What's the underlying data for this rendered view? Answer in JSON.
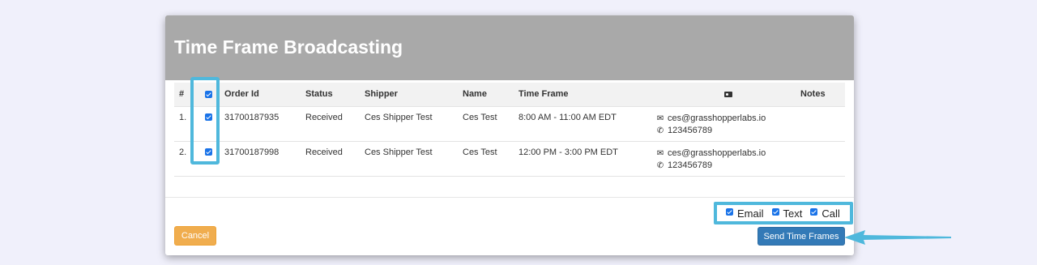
{
  "modal": {
    "title": "Time Frame Broadcasting"
  },
  "table": {
    "headers": {
      "num": "#",
      "order_id": "Order Id",
      "status": "Status",
      "shipper": "Shipper",
      "name": "Name",
      "time_frame": "Time Frame",
      "contact_icon": "contact-card-icon",
      "notes": "Notes"
    },
    "rows": [
      {
        "num": "1.",
        "checked": true,
        "order_id": "31700187935",
        "status": "Received",
        "shipper": "Ces Shipper Test",
        "name": "Ces Test",
        "time_frame": "8:00 AM - 11:00 AM EDT",
        "email": "ces@grasshopperlabs.io",
        "phone": "123456789",
        "notes": ""
      },
      {
        "num": "2.",
        "checked": true,
        "order_id": "31700187998",
        "status": "Received",
        "shipper": "Ces Shipper Test",
        "name": "Ces Test",
        "time_frame": "12:00 PM - 3:00 PM EDT",
        "email": "ces@grasshopperlabs.io",
        "phone": "123456789",
        "notes": ""
      }
    ]
  },
  "methods": {
    "email": "Email",
    "text": "Text",
    "call": "Call"
  },
  "buttons": {
    "cancel": "Cancel",
    "send": "Send Time Frames"
  },
  "colors": {
    "header_bg": "#a9a9a9",
    "highlight": "#4fb8dc",
    "cancel": "#f0ad4e",
    "send": "#337ab7",
    "checkbox": "#1a73e8"
  }
}
